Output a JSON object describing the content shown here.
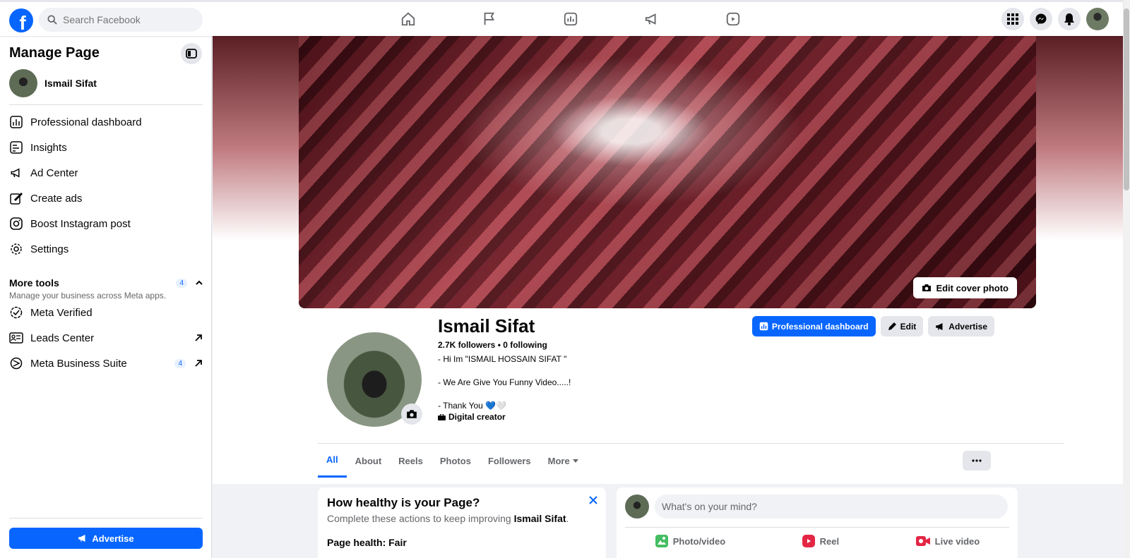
{
  "topbar": {
    "logo": "f",
    "search_placeholder": "Search Facebook",
    "nav_icons": [
      "home-icon",
      "flag-icon",
      "chart-icon",
      "megaphone-icon",
      "reels-icon"
    ],
    "right_icons": [
      "menu-grid-icon",
      "messenger-icon",
      "bell-icon",
      "account-avatar"
    ]
  },
  "sidebar": {
    "title": "Manage Page",
    "profile_name": "Ismail Sifat",
    "items": [
      {
        "label": "Professional dashboard",
        "icon": "dashboard-icon"
      },
      {
        "label": "Insights",
        "icon": "insights-icon"
      },
      {
        "label": "Ad Center",
        "icon": "megaphone-icon"
      },
      {
        "label": "Create ads",
        "icon": "pencil-icon"
      },
      {
        "label": "Boost Instagram post",
        "icon": "instagram-icon"
      },
      {
        "label": "Settings",
        "icon": "gear-icon"
      }
    ],
    "more_tools": {
      "title": "More tools",
      "subtitle": "Manage your business across Meta apps.",
      "badge": "4"
    },
    "tools": [
      {
        "label": "Meta Verified",
        "icon": "verified-icon"
      },
      {
        "label": "Leads Center",
        "icon": "leads-icon"
      },
      {
        "label": "Meta Business Suite",
        "icon": "business-suite-icon",
        "badge": "4"
      }
    ],
    "advertise_label": "Advertise"
  },
  "profile": {
    "edit_cover_label": "Edit cover photo",
    "name": "Ismail Sifat",
    "follow_stats": "2.7K followers • 0 following",
    "bio": "- Hi Im \"ISMAIL HOSSAIN SIFAT \"\n\n- We Are Give You Funny Video.....!\n\n- Thank You 💙🤍",
    "category": "Digital creator",
    "buttons": {
      "dashboard": "Professional dashboard",
      "edit": "Edit",
      "advertise": "Advertise"
    }
  },
  "tabs": [
    "All",
    "About",
    "Reels",
    "Photos",
    "Followers",
    "More"
  ],
  "health_card": {
    "title": "How healthy is your Page?",
    "subtitle_prefix": "Complete these actions to keep improving ",
    "subtitle_name": "Ismail Sifat",
    "subtitle_suffix": ".",
    "health": "Page health: Fair"
  },
  "composer": {
    "placeholder": "What's on your mind?",
    "actions": [
      "Photo/video",
      "Reel",
      "Live video"
    ]
  },
  "colors": {
    "accent": "#0866ff",
    "background": "#f0f2f5",
    "secondary_text": "#65676b"
  }
}
